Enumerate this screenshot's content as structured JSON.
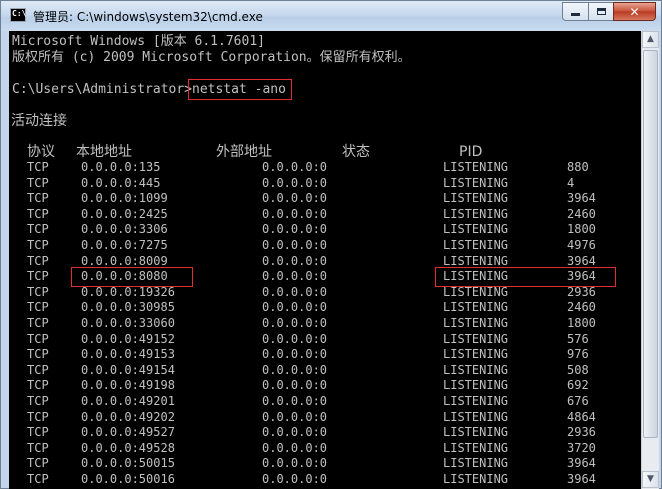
{
  "window": {
    "title": "管理员: C:\\windows\\system32\\cmd.exe",
    "icon_label": "C:\\",
    "buttons": {
      "minimize": "minimize",
      "maximize": "maximize",
      "close": "✕"
    }
  },
  "console": {
    "banner1": "Microsoft Windows [版本 6.1.7601]",
    "banner2": "版权所有 (c) 2009 Microsoft Corporation。保留所有权利。",
    "prompt": "C:\\Users\\Administrator>",
    "command": "netstat -ano",
    "section_title": "活动连接",
    "headers": [
      "协议",
      "本地地址",
      "外部地址",
      "状态",
      "PID"
    ],
    "rows": [
      [
        "TCP",
        "0.0.0.0:135",
        "0.0.0.0:0",
        "LISTENING",
        "880"
      ],
      [
        "TCP",
        "0.0.0.0:445",
        "0.0.0.0:0",
        "LISTENING",
        "4"
      ],
      [
        "TCP",
        "0.0.0.0:1099",
        "0.0.0.0:0",
        "LISTENING",
        "3964"
      ],
      [
        "TCP",
        "0.0.0.0:2425",
        "0.0.0.0:0",
        "LISTENING",
        "2460"
      ],
      [
        "TCP",
        "0.0.0.0:3306",
        "0.0.0.0:0",
        "LISTENING",
        "1800"
      ],
      [
        "TCP",
        "0.0.0.0:7275",
        "0.0.0.0:0",
        "LISTENING",
        "4976"
      ],
      [
        "TCP",
        "0.0.0.0:8009",
        "0.0.0.0:0",
        "LISTENING",
        "3964"
      ],
      [
        "TCP",
        "0.0.0.0:8080",
        "0.0.0.0:0",
        "LISTENING",
        "3964"
      ],
      [
        "TCP",
        "0.0.0.0:19326",
        "0.0.0.0:0",
        "LISTENING",
        "2936"
      ],
      [
        "TCP",
        "0.0.0.0:30985",
        "0.0.0.0:0",
        "LISTENING",
        "2460"
      ],
      [
        "TCP",
        "0.0.0.0:33060",
        "0.0.0.0:0",
        "LISTENING",
        "1800"
      ],
      [
        "TCP",
        "0.0.0.0:49152",
        "0.0.0.0:0",
        "LISTENING",
        "576"
      ],
      [
        "TCP",
        "0.0.0.0:49153",
        "0.0.0.0:0",
        "LISTENING",
        "976"
      ],
      [
        "TCP",
        "0.0.0.0:49154",
        "0.0.0.0:0",
        "LISTENING",
        "508"
      ],
      [
        "TCP",
        "0.0.0.0:49198",
        "0.0.0.0:0",
        "LISTENING",
        "692"
      ],
      [
        "TCP",
        "0.0.0.0:49201",
        "0.0.0.0:0",
        "LISTENING",
        "676"
      ],
      [
        "TCP",
        "0.0.0.0:49202",
        "0.0.0.0:0",
        "LISTENING",
        "4864"
      ],
      [
        "TCP",
        "0.0.0.0:49527",
        "0.0.0.0:0",
        "LISTENING",
        "2936"
      ],
      [
        "TCP",
        "0.0.0.0:49528",
        "0.0.0.0:0",
        "LISTENING",
        "3720"
      ],
      [
        "TCP",
        "0.0.0.0:50015",
        "0.0.0.0:0",
        "LISTENING",
        "3964"
      ],
      [
        "TCP",
        "0.0.0.0:50016",
        "0.0.0.0:0",
        "LISTENING",
        "3964"
      ]
    ],
    "highlight_row": 7,
    "colors": {
      "text": "#c0c0c0",
      "background": "#000000",
      "highlight": "#e12d2d"
    }
  },
  "scrollbar": {
    "up_arrow": "▲",
    "down_arrow": "▼"
  }
}
